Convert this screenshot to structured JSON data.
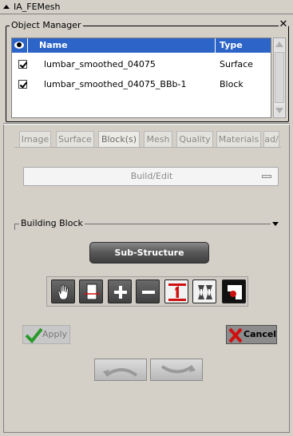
{
  "window": {
    "title": "IA_FEMesh",
    "collapse_icon": "triangle-up-icon"
  },
  "object_manager": {
    "title": "Object Manager",
    "close_icon": "close-icon",
    "columns": [
      {
        "icon": "eye-icon"
      },
      {
        "label": "Name"
      },
      {
        "label": "Type"
      }
    ],
    "rows": [
      {
        "visible": true,
        "name": "lumbar_smoothed_04075",
        "type": "Surface"
      },
      {
        "visible": true,
        "name": "lumbar_smoothed_04075_BBb-1",
        "type": "Block"
      }
    ]
  },
  "tabs": [
    {
      "label": "Image",
      "active": false
    },
    {
      "label": "Surface",
      "active": false
    },
    {
      "label": "Block(s)",
      "active": true
    },
    {
      "label": "Mesh",
      "active": false
    },
    {
      "label": "Quality",
      "active": false
    },
    {
      "label": "Materials",
      "active": false
    },
    {
      "label": "ad/",
      "active": false
    }
  ],
  "mode_dropdown": {
    "selected": "Build/Edit"
  },
  "building_block": {
    "title": "Building Block",
    "substructure_label": "Sub-Structure",
    "tools": [
      {
        "icon": "hand-icon"
      },
      {
        "icon": "block-select-icon"
      },
      {
        "icon": "plus-icon"
      },
      {
        "icon": "minus-icon"
      },
      {
        "icon": "number-one-icon"
      },
      {
        "icon": "split-icon"
      },
      {
        "icon": "corner-mark-icon"
      }
    ]
  },
  "actions": {
    "apply_label": "Apply",
    "cancel_label": "Cancel"
  },
  "navigation": {
    "undo_icon": "undo-arrow-icon",
    "redo_icon": "redo-arrow-icon"
  },
  "colors": {
    "header_blue": "#2c64c8",
    "cancel_x": "#d01010",
    "apply_check": "#2a9a2a"
  }
}
